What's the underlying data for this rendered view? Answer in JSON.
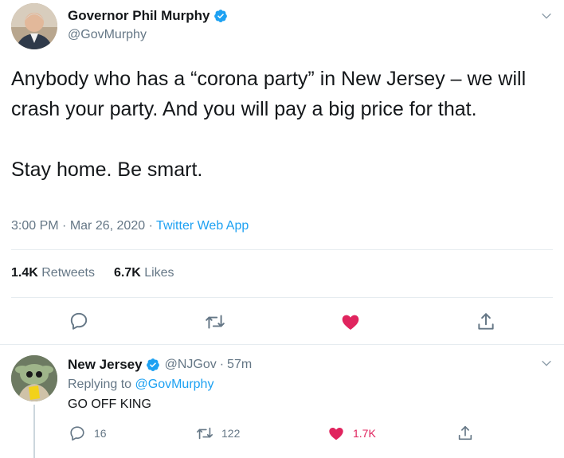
{
  "tweet": {
    "author_name": "Governor Phil Murphy",
    "author_handle": "@GovMurphy",
    "text": "Anybody who has a “corona party” in New Jersey – we will crash your party. And you will pay a big price for that.\n\nStay home. Be smart.",
    "time": "3:00 PM",
    "date": "Mar 26, 2020",
    "separator": "·",
    "app": "Twitter Web App",
    "retweets_count": "1.4K",
    "retweets_label": "Retweets",
    "likes_count": "6.7K",
    "likes_label": "Likes",
    "liked": true
  },
  "reply": {
    "author_name": "New Jersey",
    "author_handle": "@NJGov",
    "separator": "·",
    "age": "57m",
    "replying_prefix": "Replying to",
    "replying_to": "@GovMurphy",
    "text": "GO OFF KING",
    "reply_count": "16",
    "retweet_count": "122",
    "like_count": "1.7K"
  },
  "colors": {
    "accent": "#1da1f2",
    "like": "#e0245e",
    "muted": "#657786",
    "text": "#14171a"
  }
}
